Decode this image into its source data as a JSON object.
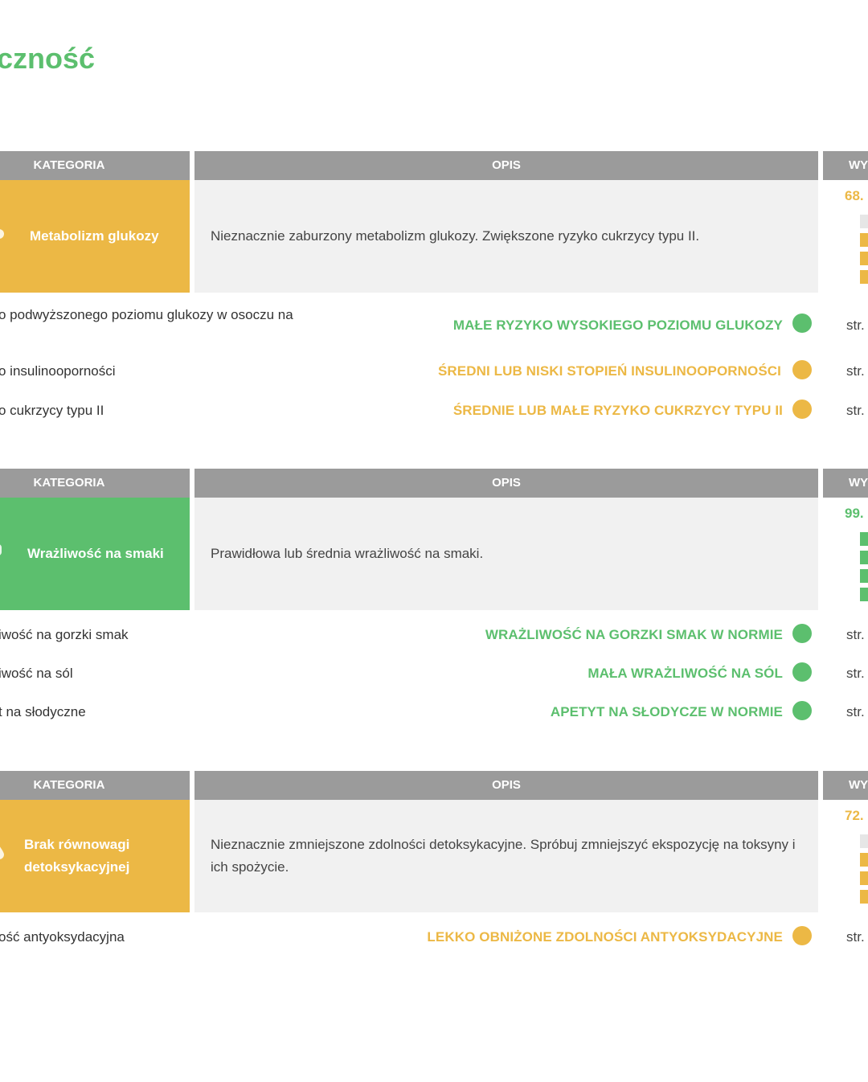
{
  "page": {
    "title": "czność"
  },
  "colors": {
    "green": "#5cbf6e",
    "yellow": "#ecb845",
    "header_gray": "#9b9b9b",
    "desc_bg": "#f1f1f1"
  },
  "headers": {
    "kategoria": "KATEGORIA",
    "opis": "OPIS",
    "wynik": "WY"
  },
  "sections": [
    {
      "category": "Metabolizm glukozy",
      "category_color": "yellow",
      "icon": "apple-icon",
      "description": "Nieznacznie zaburzony metabolizm glukozy. Zwiększone ryzyko cukrzycy typu II.",
      "score": "68.",
      "rows": [
        {
          "label": "o podwyższonego poziomu glukozy w osoczu na",
          "result": "MAŁE RYZYKO WYSOKIEGO POZIOMU GLUKOZY",
          "status": "green",
          "page": "str."
        },
        {
          "label": "o insulinooporności",
          "result": "ŚREDNI LUB NISKI STOPIEŃ INSULINOOPORNOŚCI",
          "status": "yellow",
          "page": "str."
        },
        {
          "label": "o cukrzycy typu II",
          "result": "ŚREDNIE LUB MAŁE RYZYKO CUKRZYCY TYPU II",
          "status": "yellow",
          "page": "str."
        }
      ]
    },
    {
      "category": "Wrażliwość na smaki",
      "category_color": "green",
      "icon": "tongue-icon",
      "description": "Prawidłowa lub średnia wrażliwość na smaki.",
      "score": "99.",
      "rows": [
        {
          "label": "iwość na gorzki smak",
          "result": "WRAŻLIWOŚĆ NA GORZKI SMAK W NORMIE",
          "status": "green",
          "page": "str."
        },
        {
          "label": "iwość na sól",
          "result": "MAŁA WRAŻLIWOŚĆ NA SÓL",
          "status": "green",
          "page": "str."
        },
        {
          "label": "t na słodyczne",
          "result": "APETYT NA SŁODYCZE W NORMIE",
          "status": "green",
          "page": "str."
        }
      ]
    },
    {
      "category": "Brak równowagi detoksykacyjnej",
      "category_color": "yellow",
      "icon": "drop-icon",
      "description": "Nieznacznie zmniejszone zdolności detoksykacyjne. Spróbuj zmniejszyć ekspozycję na toksyny i ich spożycie.",
      "score": "72.",
      "rows": [
        {
          "label": "ość antyoksydacyjna",
          "result": "LEKKO OBNIŻONE ZDOLNOŚCI ANTYOKSYDACYJNE",
          "status": "yellow",
          "page": "str."
        }
      ]
    }
  ]
}
